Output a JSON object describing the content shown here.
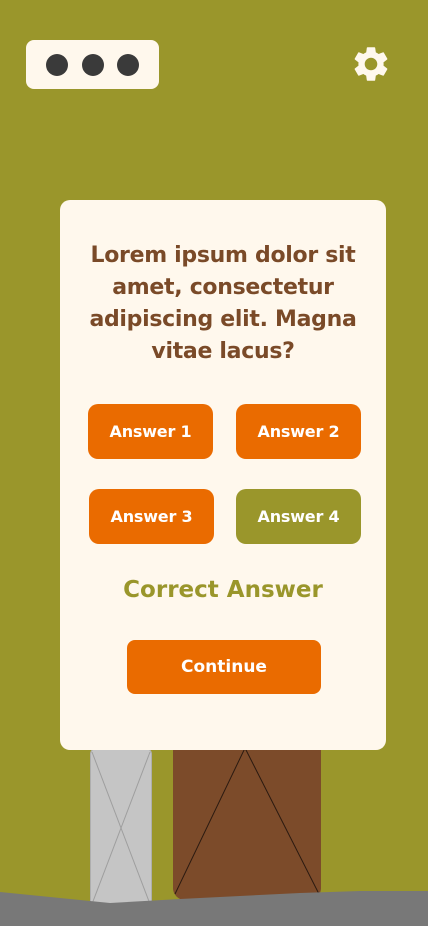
{
  "header": {
    "menu_icon": "more-dots-icon",
    "settings_icon": "gear-icon"
  },
  "quiz": {
    "question": "Lorem ipsum dolor sit amet, consectetur adipiscing elit. Magna vitae lacus?",
    "answers": [
      {
        "label": "Answer 1",
        "state": "incorrect"
      },
      {
        "label": "Answer 2",
        "state": "incorrect"
      },
      {
        "label": "Answer 3",
        "state": "incorrect"
      },
      {
        "label": "Answer 4",
        "state": "correct"
      }
    ],
    "feedback": "Correct Answer",
    "continue_label": "Continue"
  },
  "colors": {
    "background": "#9a962b",
    "card": "#fff8ed",
    "accent": "#ea6b00",
    "correct": "#9a962b",
    "question_text": "#7a4a28"
  }
}
